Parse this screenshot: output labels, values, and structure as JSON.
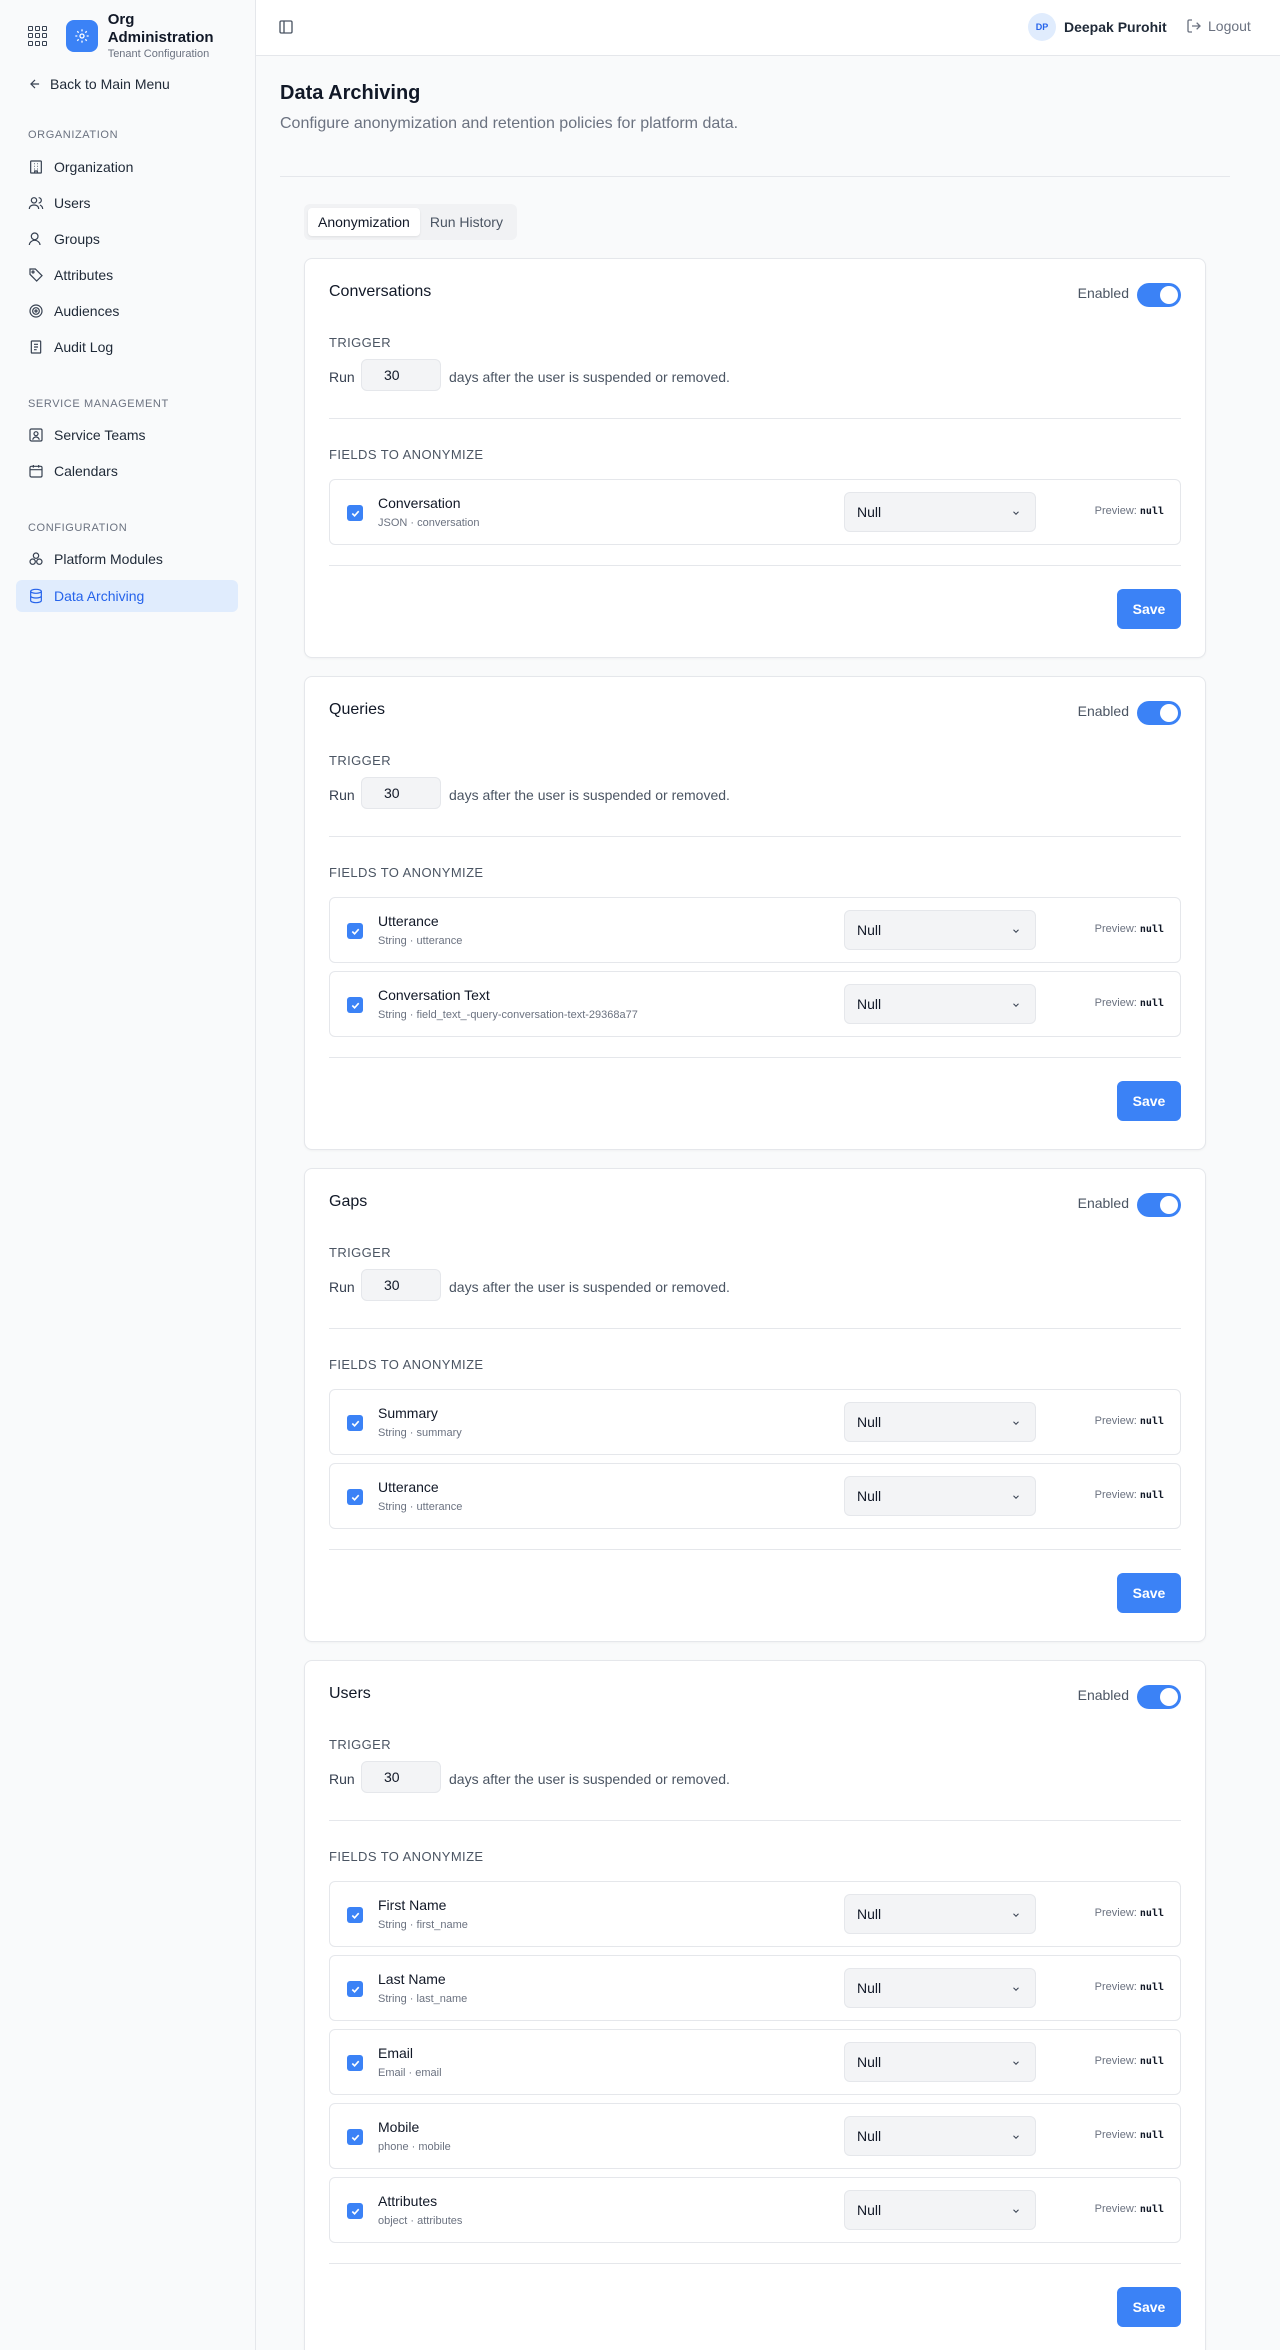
{
  "brand": {
    "title": "Org Administration",
    "subtitle": "Tenant Configuration"
  },
  "sidebar": {
    "back_label": "Back to Main Menu",
    "sections": [
      {
        "label": "ORGANIZATION"
      },
      {
        "label": "SERVICE MANAGEMENT"
      },
      {
        "label": "CONFIGURATION"
      }
    ],
    "items": [
      {
        "label": "Organization",
        "icon": "building-icon"
      },
      {
        "label": "Users",
        "icon": "users-icon"
      },
      {
        "label": "Groups",
        "icon": "group-icon"
      },
      {
        "label": "Attributes",
        "icon": "tag-icon"
      },
      {
        "label": "Audiences",
        "icon": "target-icon"
      },
      {
        "label": "Audit Log",
        "icon": "log-icon"
      },
      {
        "label": "Service Teams",
        "icon": "team-icon"
      },
      {
        "label": "Calendars",
        "icon": "calendar-icon"
      },
      {
        "label": "Platform Modules",
        "icon": "modules-icon"
      },
      {
        "label": "Data Archiving",
        "icon": "database-icon",
        "active": true
      }
    ]
  },
  "topbar": {
    "user_initials": "DP",
    "user_name": "Deepak Purohit",
    "logout_label": "Logout"
  },
  "page": {
    "title": "Data Archiving",
    "description": "Configure anonymization and retention policies for platform data."
  },
  "tabs": [
    {
      "label": "Anonymization",
      "active": true
    },
    {
      "label": "Run History",
      "active": false
    }
  ],
  "common": {
    "enabled_label": "Enabled",
    "trigger_label": "TRIGGER",
    "run_label": "Run",
    "after_text": "days after the user is suspended or removed.",
    "fields_label": "FIELDS TO ANONYMIZE",
    "preview_label": "Preview:",
    "save_label": "Save",
    "accent": "#3b82f6"
  },
  "cards": [
    {
      "title": "Conversations",
      "enabled": true,
      "days": "30",
      "fields": [
        {
          "name": "Conversation",
          "meta": "JSON · conversation",
          "strategy": "Null",
          "preview": "null",
          "checked": true
        }
      ]
    },
    {
      "title": "Queries",
      "enabled": true,
      "days": "30",
      "fields": [
        {
          "name": "Utterance",
          "meta": "String · utterance",
          "strategy": "Null",
          "preview": "null",
          "checked": true
        },
        {
          "name": "Conversation Text",
          "meta": "String · field_text_-query-conversation-text-29368a77",
          "strategy": "Null",
          "preview": "null",
          "checked": true
        }
      ]
    },
    {
      "title": "Gaps",
      "enabled": true,
      "days": "30",
      "fields": [
        {
          "name": "Summary",
          "meta": "String · summary",
          "strategy": "Null",
          "preview": "null",
          "checked": true
        },
        {
          "name": "Utterance",
          "meta": "String · utterance",
          "strategy": "Null",
          "preview": "null",
          "checked": true
        }
      ]
    },
    {
      "title": "Users",
      "enabled": true,
      "days": "30",
      "fields": [
        {
          "name": "First Name",
          "meta": "String · first_name",
          "strategy": "Null",
          "preview": "null",
          "checked": true
        },
        {
          "name": "Last Name",
          "meta": "String · last_name",
          "strategy": "Null",
          "preview": "null",
          "checked": true
        },
        {
          "name": "Email",
          "meta": "Email · email",
          "strategy": "Null",
          "preview": "null",
          "checked": true
        },
        {
          "name": "Mobile",
          "meta": "phone · mobile",
          "strategy": "Null",
          "preview": "null",
          "checked": true
        },
        {
          "name": "Attributes",
          "meta": "object · attributes",
          "strategy": "Null",
          "preview": "null",
          "checked": true
        }
      ]
    }
  ]
}
